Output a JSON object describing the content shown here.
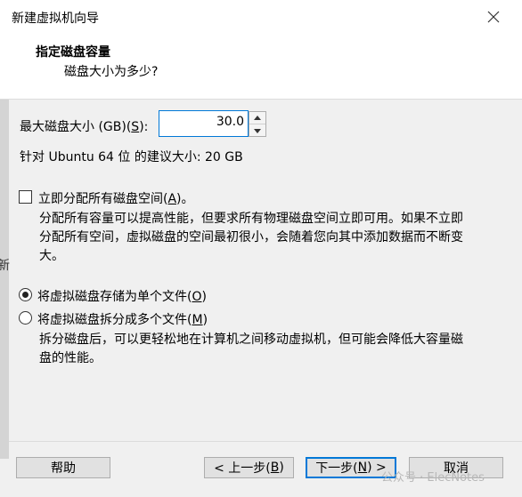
{
  "window": {
    "title": "新建虚拟机向导"
  },
  "header": {
    "title": "指定磁盘容量",
    "subtitle": "磁盘大小为多少?"
  },
  "left_strip": {
    "glyph": "新"
  },
  "disk_size": {
    "label_prefix": "最大磁盘大小 (GB)(",
    "label_mnemonic": "S",
    "label_suffix": "):",
    "value": "30.0",
    "recommendation": "针对 Ubuntu 64 位 的建议大小: 20 GB"
  },
  "allocate": {
    "checked": false,
    "label_prefix": "立即分配所有磁盘空间(",
    "label_mnemonic": "A",
    "label_suffix": ")。",
    "desc_line1": "分配所有容量可以提高性能，但要求所有物理磁盘空间立即可用。如果不立即",
    "desc_line2": "分配所有空间，虚拟磁盘的空间最初很小，会随着您向其中添加数据而不断变",
    "desc_line3": "大。"
  },
  "storage": {
    "single": {
      "selected": true,
      "label_prefix": "将虚拟磁盘存储为单个文件(",
      "label_mnemonic": "O",
      "label_suffix": ")"
    },
    "multiple": {
      "selected": false,
      "label_prefix": "将虚拟磁盘拆分成多个文件(",
      "label_mnemonic": "M",
      "label_suffix": ")",
      "desc_line1": "拆分磁盘后，可以更轻松地在计算机之间移动虚拟机，但可能会降低大容量磁",
      "desc_line2": "盘的性能。"
    }
  },
  "buttons": {
    "help": "帮助",
    "back_prefix": "< 上一步(",
    "back_mnemonic": "B",
    "back_suffix": ")",
    "next_prefix": "下一步(",
    "next_mnemonic": "N",
    "next_suffix": ") >",
    "cancel": "取消"
  },
  "watermark": {
    "text": "公众号 · ElecNotes"
  }
}
